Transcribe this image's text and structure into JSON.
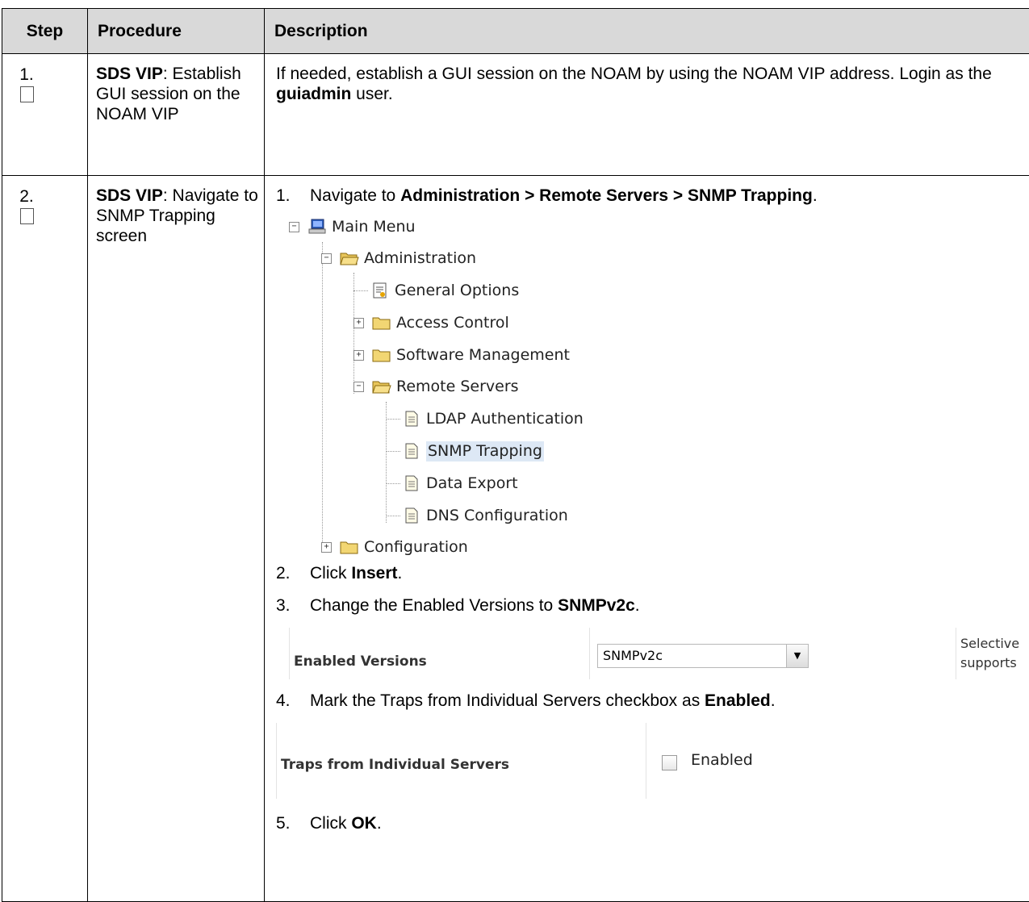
{
  "header": {
    "step": "Step",
    "procedure": "Procedure",
    "description": "Description"
  },
  "rows": [
    {
      "num": "1.",
      "proc_bold": "SDS VIP",
      "proc_rest": ": Establish GUI session on the NOAM VIP",
      "desc_pre": "If needed, establish a GUI session on the NOAM by using the NOAM VIP address.  Login as the ",
      "desc_bold": "guiadmin",
      "desc_post": " user."
    },
    {
      "num": "2.",
      "proc_bold": "SDS VIP",
      "proc_rest": ": Navigate to SNMP Trapping screen"
    }
  ],
  "steps": [
    {
      "n": "1.",
      "pre": "Navigate to ",
      "bold": "Administration > Remote Servers > SNMP Trapping",
      "post": "."
    },
    {
      "n": "2.",
      "pre": "Click ",
      "bold": "Insert",
      "post": "."
    },
    {
      "n": "3.",
      "pre": "Change the Enabled Versions to ",
      "bold": "SNMPv2c",
      "post": "."
    },
    {
      "n": "4.",
      "pre": "Mark the Traps from Individual Servers checkbox as ",
      "bold": "Enabled",
      "post": "."
    },
    {
      "n": "5.",
      "pre": "Click ",
      "bold": "OK",
      "post": "."
    }
  ],
  "tree": {
    "main_menu": "Main Menu",
    "administration": "Administration",
    "general_options": "General Options",
    "access_control": "Access Control",
    "software_management": "Software Management",
    "remote_servers": "Remote Servers",
    "ldap_authentication": "LDAP Authentication",
    "snmp_trapping": "SNMP Trapping",
    "data_export": "Data Export",
    "dns_configuration": "DNS Configuration",
    "configuration": "Configuration"
  },
  "enabled_versions": {
    "label": "Enabled Versions",
    "value": "SNMPv2c",
    "aside_1": "Selective",
    "aside_2": "supports"
  },
  "traps": {
    "label": "Traps from Individual Servers",
    "checkbox_label": "Enabled",
    "checked": false
  }
}
